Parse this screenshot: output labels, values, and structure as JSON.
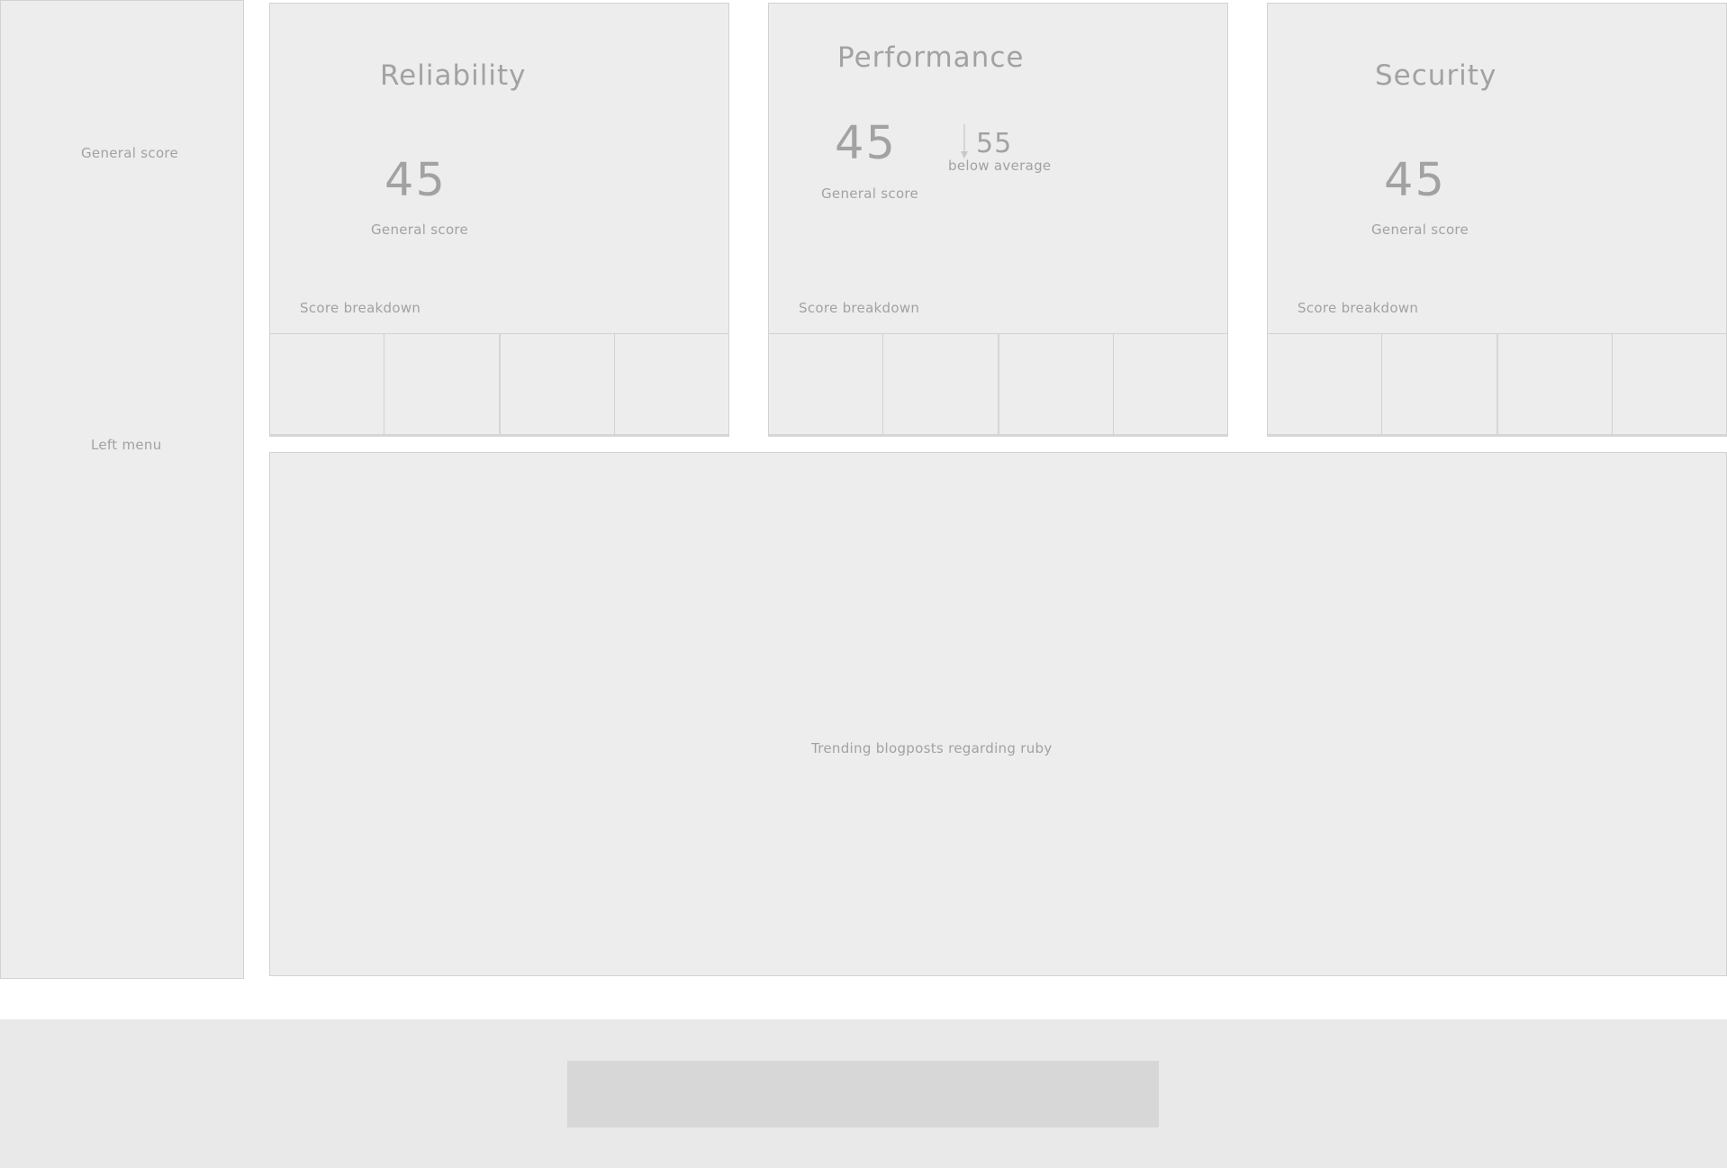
{
  "left_menu": {
    "general_score_label": "General score",
    "menu_label": "Left menu"
  },
  "cards": [
    {
      "title": "Reliability",
      "score": "45",
      "score_label": "General score",
      "breakdown_label": "Score breakdown"
    },
    {
      "title": "Performance",
      "score": "45",
      "score_label": "General score",
      "average": "55",
      "average_label": "below average",
      "breakdown_label": "Score breakdown"
    },
    {
      "title": "Security",
      "score": "45",
      "score_label": "General score",
      "breakdown_label": "Score breakdown"
    }
  ],
  "trending": {
    "label": "Trending blogposts regarding ruby"
  },
  "icons": {
    "trend_arrow": "arrow-down-icon"
  }
}
